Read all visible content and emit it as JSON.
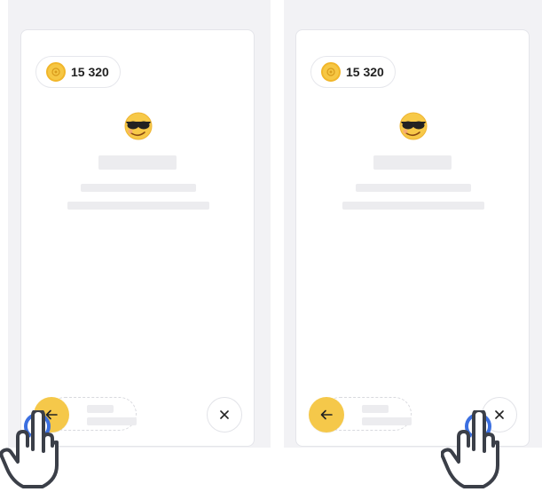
{
  "colors": {
    "panel_bg": "#f2f2f5",
    "card_bg": "#ffffff",
    "accent_yellow": "#f5c84a",
    "tap_indicator": "#3b6fe0",
    "hand_stroke": "#3b3f48"
  },
  "screens": [
    {
      "coins": {
        "amount": "15 320",
        "icon": "coin-icon"
      },
      "emoji": "smiling-face-with-sunglasses",
      "back_button": {
        "icon": "arrow-left-icon"
      },
      "close_button": {
        "icon": "close-icon"
      },
      "tap_target": "back-button"
    },
    {
      "coins": {
        "amount": "15 320",
        "icon": "coin-icon"
      },
      "emoji": "smiling-face-with-sunglasses",
      "back_button": {
        "icon": "arrow-left-icon"
      },
      "close_button": {
        "icon": "close-icon"
      },
      "tap_target": "close-button"
    }
  ]
}
